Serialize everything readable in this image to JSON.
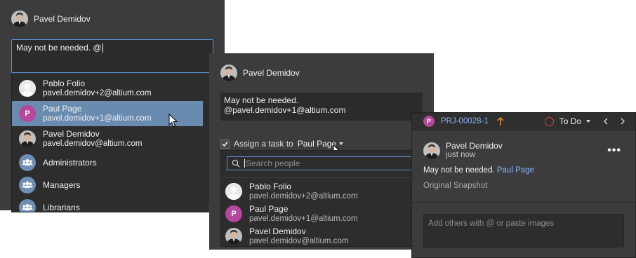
{
  "panel_left": {
    "user_name": "Pavel Demidov",
    "comment_text": "May not be needed. @",
    "suggestions": [
      {
        "name": "Pablo Folio",
        "email": "pavel.demidov+2@altium.com",
        "avatar": "blank-avatar"
      },
      {
        "name": "Paul Page",
        "email": "pavel.demidov+1@altium.com",
        "avatar": "P",
        "highlighted": true
      },
      {
        "name": "Pavel Demidov",
        "email": "pavel.demidov@altium.com",
        "avatar": "photo"
      },
      {
        "name": "Administrators",
        "avatar": "group-icon"
      },
      {
        "name": "Managers",
        "avatar": "group-icon"
      },
      {
        "name": "Librarians",
        "avatar": "group-icon"
      }
    ]
  },
  "panel_middle": {
    "user_name": "Pavel Demidov",
    "comment_text": "May not be needed. @pavel.demidov+1@altium.com",
    "assign_label": "Assign a task to",
    "assignee": "Paul Page",
    "search_placeholder": "Search people",
    "people": [
      {
        "name": "Pablo Folio",
        "email": "pavel.demidov+2@altium.com",
        "avatar": "blank-avatar"
      },
      {
        "name": "Paul Page",
        "email": "pavel.demidov+1@altium.com",
        "avatar": "P"
      },
      {
        "name": "Pavel Demidov",
        "email": "pavel.demidov@altium.com",
        "avatar": "photo"
      }
    ]
  },
  "panel_right": {
    "badge_initial": "P",
    "project_id": "PRJ-00028-1",
    "status": "To Do",
    "author": "Pavel Demidov",
    "time": "just now",
    "message_text": "May not be needed.",
    "mention": "Paul Page",
    "snapshot_label": "Original Snapshot",
    "reply_placeholder": "Add others with @ or paste images"
  },
  "colors": {
    "panel_bg": "#3c3c3c",
    "dropdown_bg": "#2d2d2d",
    "highlight": "#6a8bb0",
    "link": "#8ab4f8",
    "accent_purple": "#b5479c",
    "priority_orange": "#e8953a",
    "status_red": "#e04040"
  }
}
